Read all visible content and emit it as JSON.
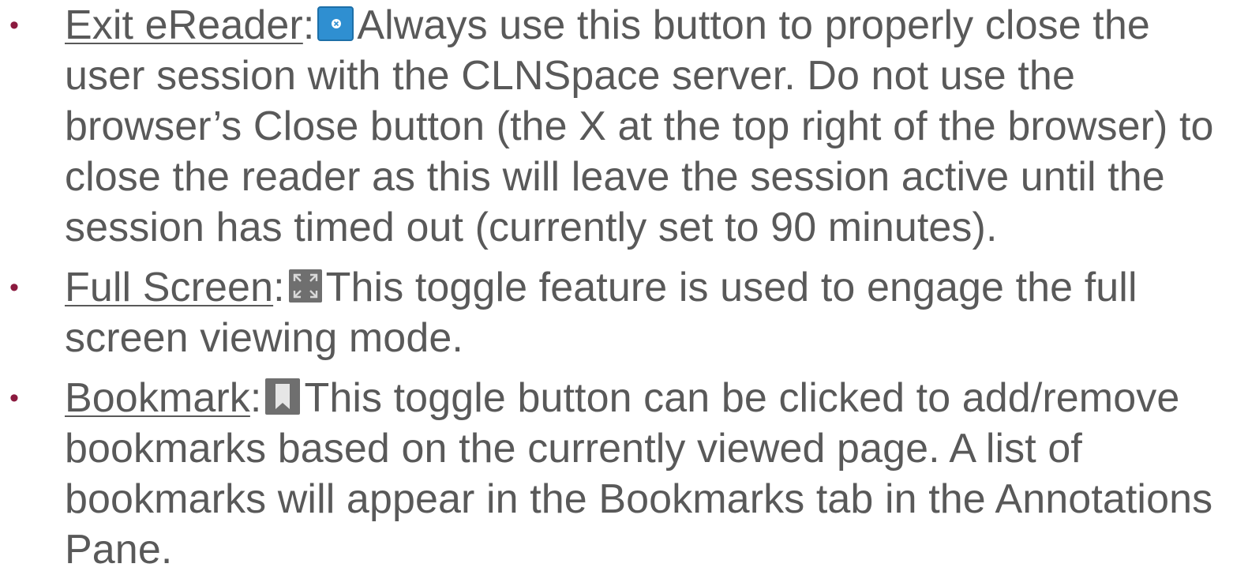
{
  "colors": {
    "text": "#595959",
    "bullet": "#8b1a3f",
    "exit_icon": "#2f8fd1",
    "icon_gray": "#6f6f6f"
  },
  "items": [
    {
      "term": "Exit eReader",
      "separator": ":",
      "icon": "exit-ereader-icon",
      "text": "Always use this button to properly close the user session with the CLNSpace server. Do not use the browser’s Close button (the X at the top right of the browser) to close the reader as this will leave the session active until the session has timed out (currently set to 90 minutes)."
    },
    {
      "term": "Full Screen",
      "separator": ":",
      "icon": "full-screen-icon",
      "text": "This toggle feature is used to engage the full screen viewing mode."
    },
    {
      "term": "Bookmark",
      "separator": ":",
      "icon": "bookmark-icon",
      "text": "This toggle button can be clicked to add/remove bookmarks based on the currently viewed page. A list of bookmarks will appear in the Bookmarks tab in the Annotations Pane."
    }
  ]
}
